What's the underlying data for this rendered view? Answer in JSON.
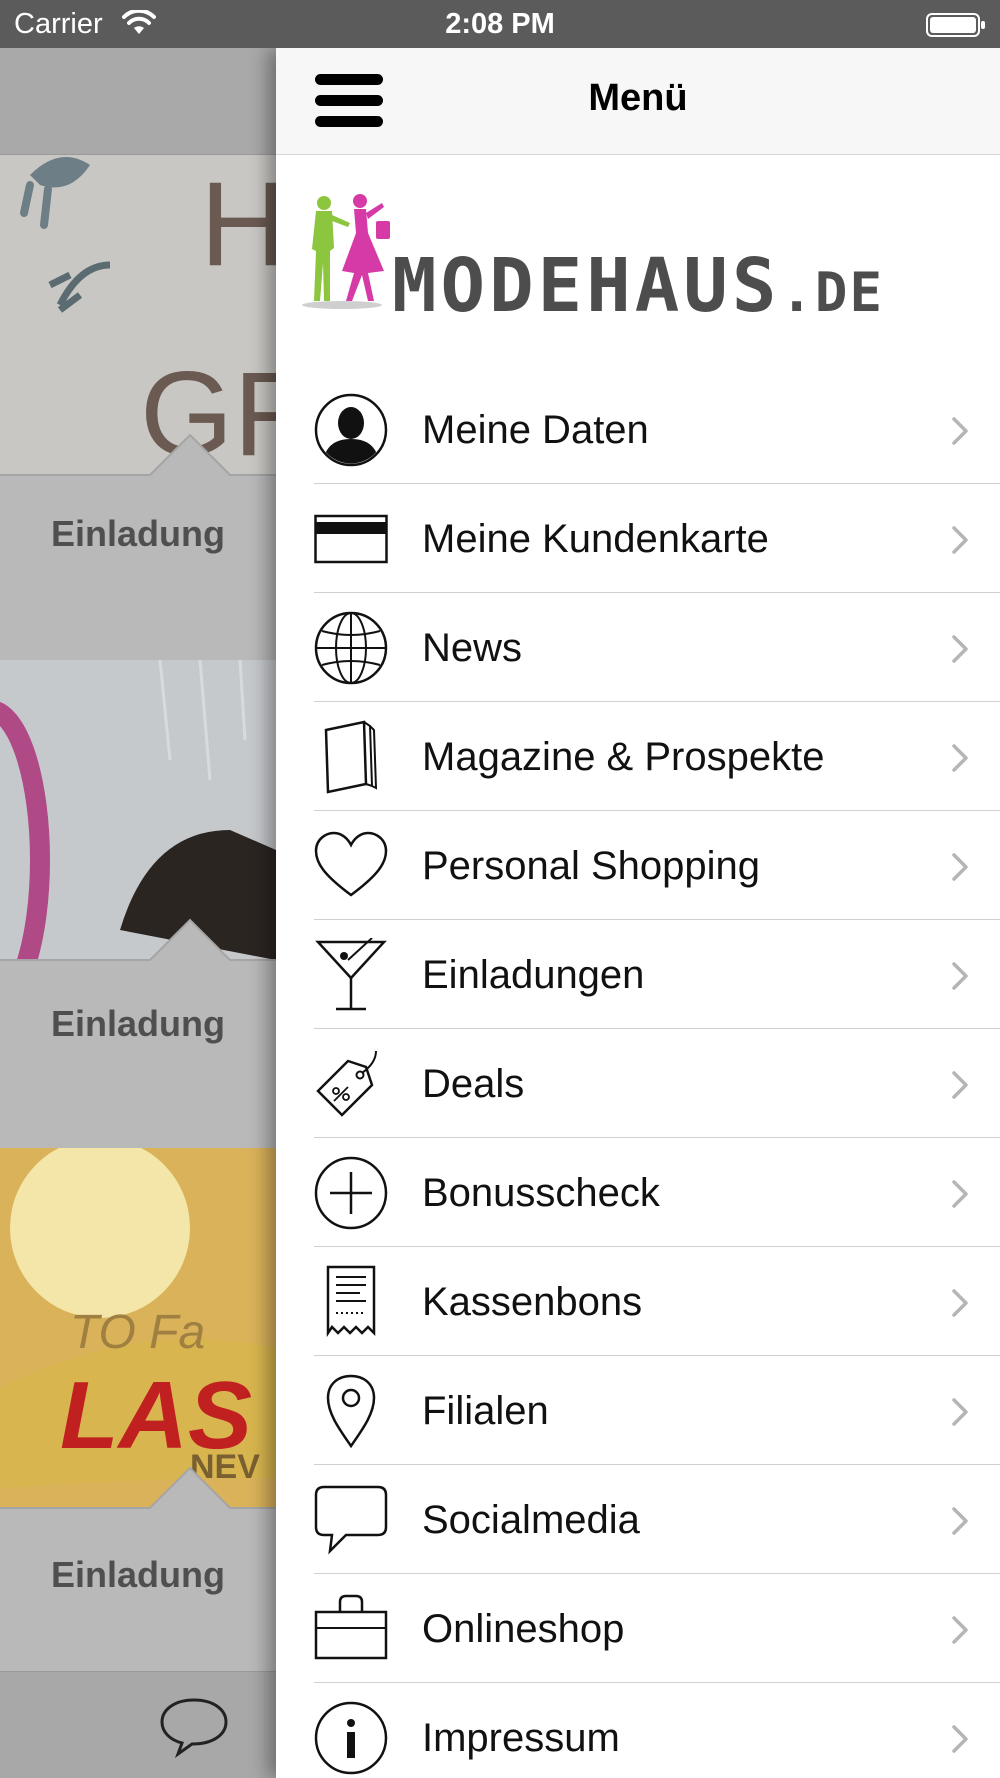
{
  "status_bar": {
    "carrier": "Carrier",
    "time": "2:08 PM"
  },
  "background": {
    "cards": [
      {
        "label": "Einladung"
      },
      {
        "label": "Einladung"
      },
      {
        "label": "Einladung"
      }
    ],
    "tabbar_icon": "chat-bubble-icon"
  },
  "drawer": {
    "title": "Menü",
    "menu_icon": "hamburger-icon",
    "logo": {
      "text": "MODEHAUS",
      "suffix": ".DE"
    },
    "items": [
      {
        "label": "Meine Daten",
        "icon": "person-icon"
      },
      {
        "label": "Meine Kundenkarte",
        "icon": "card-icon"
      },
      {
        "label": "News",
        "icon": "globe-icon"
      },
      {
        "label": "Magazine & Prospekte",
        "icon": "magazine-icon"
      },
      {
        "label": "Personal Shopping",
        "icon": "heart-icon"
      },
      {
        "label": "Einladungen",
        "icon": "cocktail-icon"
      },
      {
        "label": "Deals",
        "icon": "tag-icon"
      },
      {
        "label": "Bonusscheck",
        "icon": "plus-circle-icon"
      },
      {
        "label": "Kassenbons",
        "icon": "receipt-icon"
      },
      {
        "label": "Filialen",
        "icon": "location-pin-icon"
      },
      {
        "label": "Socialmedia",
        "icon": "speech-bubble-icon"
      },
      {
        "label": "Onlineshop",
        "icon": "shopping-bag-icon"
      },
      {
        "label": "Impressum",
        "icon": "info-icon"
      }
    ]
  },
  "colors": {
    "accent_pink": "#d63aa6",
    "accent_green": "#8cc63f",
    "logo_gray": "#4d4d4d"
  }
}
